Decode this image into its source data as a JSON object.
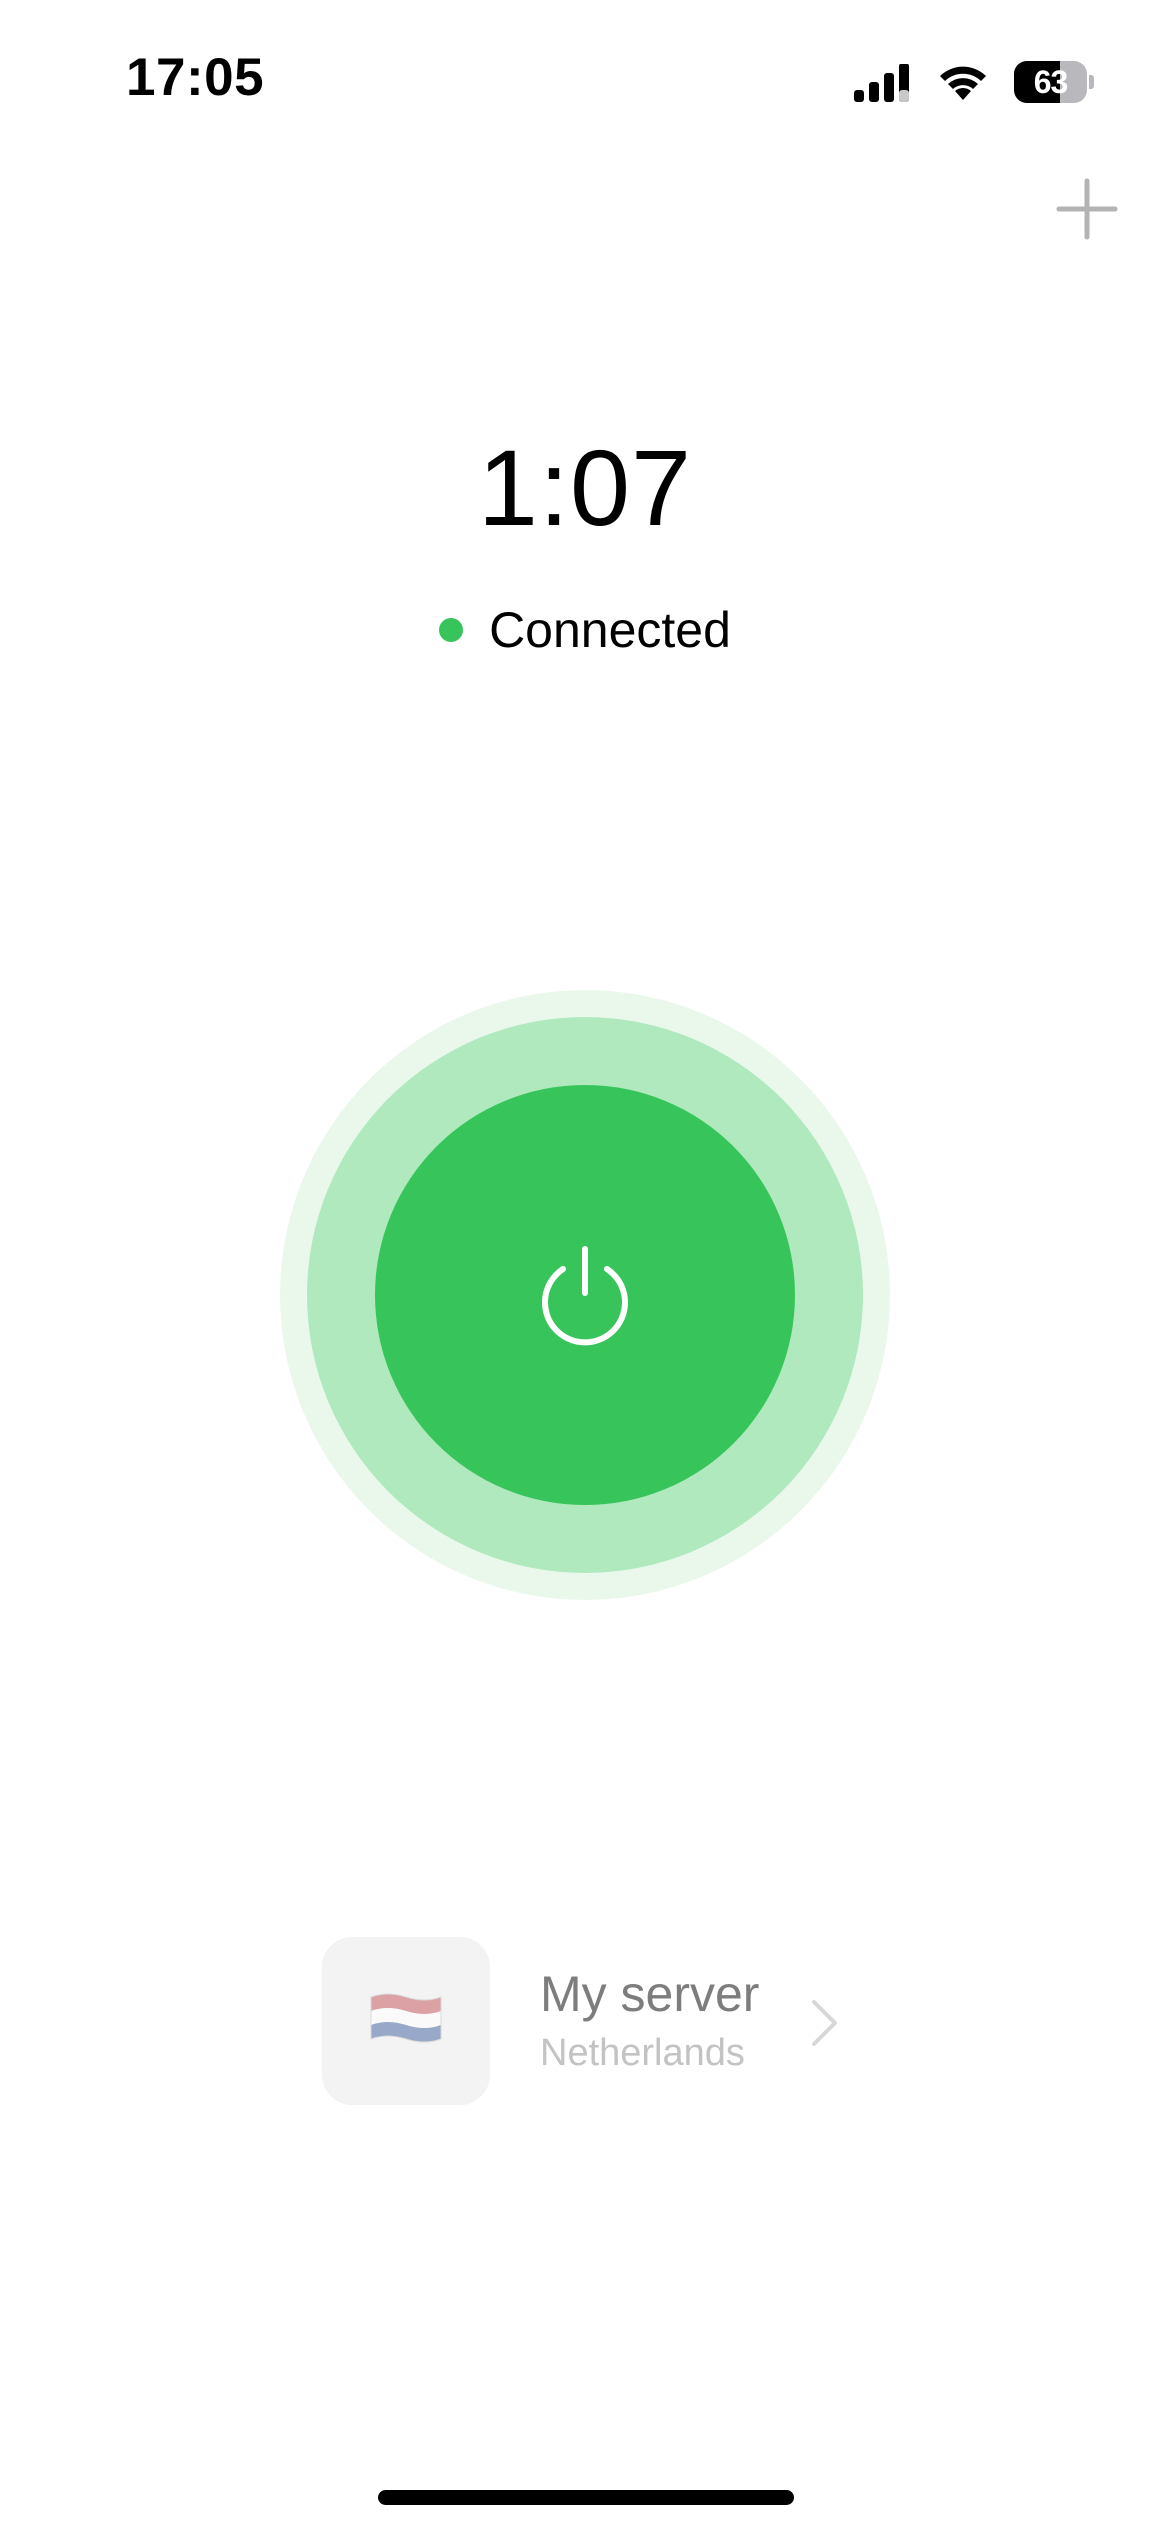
{
  "status_bar": {
    "time": "17:05",
    "battery_percent": "63",
    "battery_level": 0.63,
    "icons": [
      "cellular-signal-icon",
      "wifi-icon",
      "battery-icon"
    ]
  },
  "header": {
    "add_icon": "plus-icon"
  },
  "connection": {
    "timer": "1:07",
    "status": "Connected",
    "status_color": "#37c55b",
    "power_icon": "power-icon",
    "accent_color": "#37c55b"
  },
  "server": {
    "name": "My server",
    "location": "Netherlands",
    "flag_icon": "netherlands-flag-icon",
    "chevron_icon": "chevron-right-icon"
  }
}
